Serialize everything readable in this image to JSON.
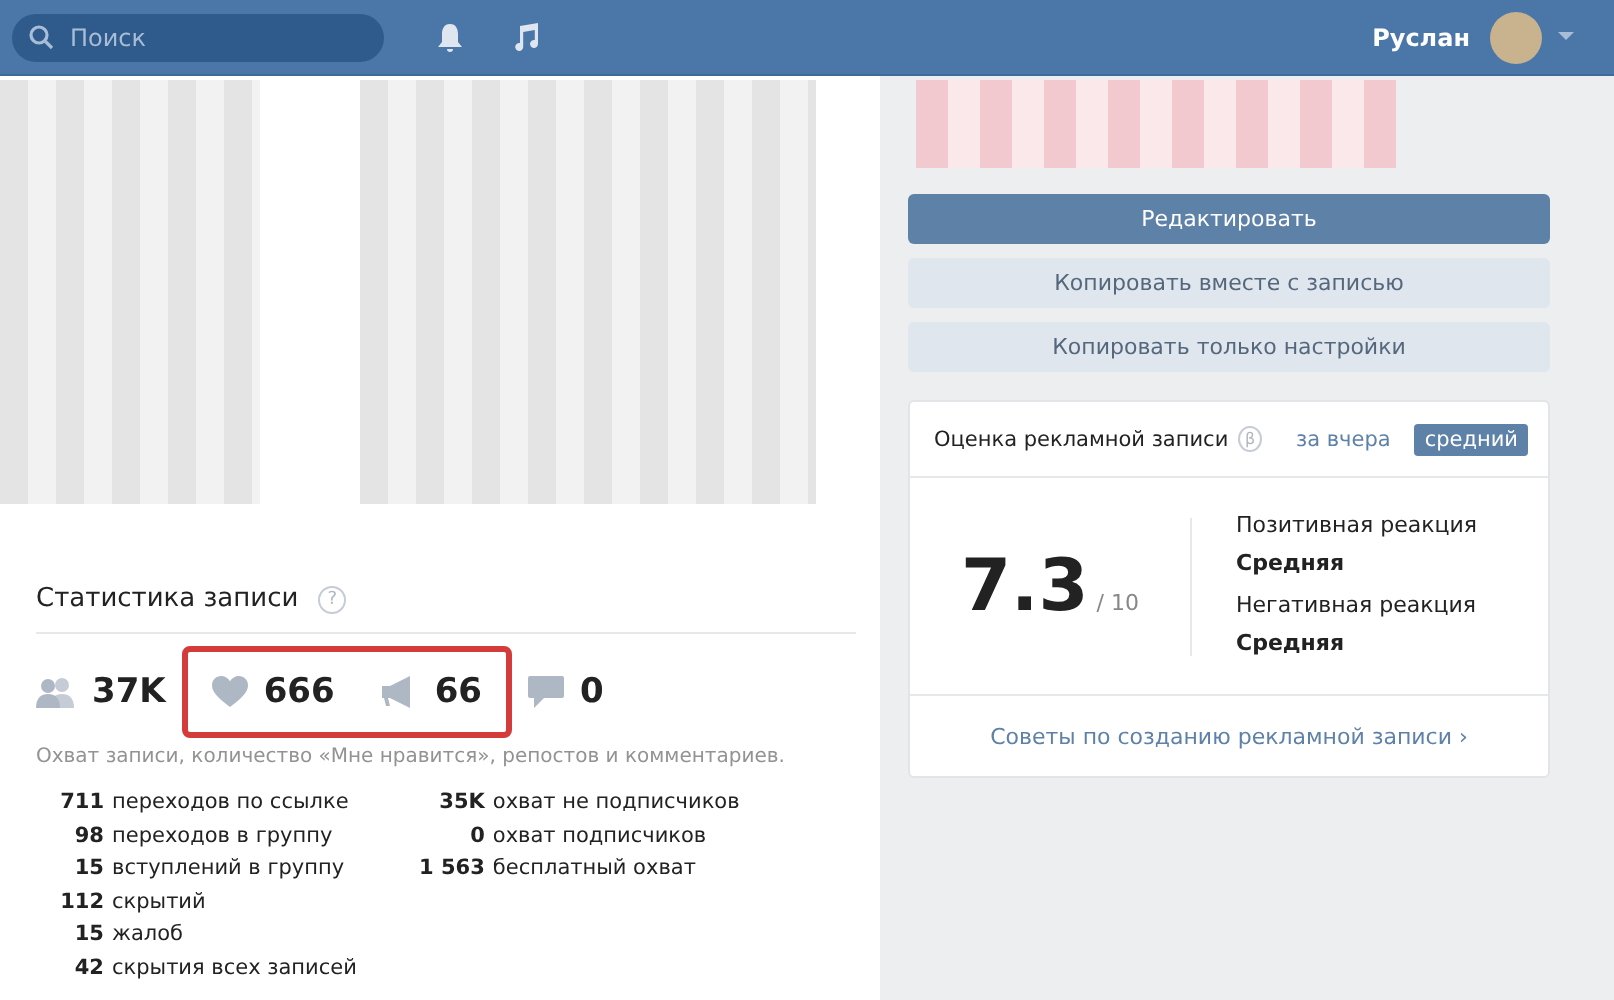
{
  "header": {
    "search": {
      "placeholder": "Поиск"
    },
    "user": {
      "name": "Руслан"
    }
  },
  "actions": [
    {
      "label": "Редактировать",
      "kind": "primary"
    },
    {
      "label": "Копировать вместе с записью",
      "kind": "secondary"
    },
    {
      "label": "Копировать только настройки",
      "kind": "secondary"
    }
  ],
  "rating": {
    "title": "Оценка рекламной записи",
    "info": "β",
    "tabs": [
      {
        "label": "за вчера",
        "selected": false
      },
      {
        "label": "средний",
        "selected": true
      }
    ],
    "score": "7.3",
    "scale": "/ 10",
    "reactions": [
      {
        "label": "Позитивная реакция",
        "value": "Средняя"
      },
      {
        "label": "Негативная реакция",
        "value": "Средняя"
      }
    ],
    "link": "Советы по созданию рекламной записи ›"
  },
  "stats": {
    "title": "Статистика записи",
    "help": "?",
    "counters": [
      {
        "kind": "reach",
        "value": "37K",
        "highlighted": false
      },
      {
        "kind": "likes",
        "value": "666",
        "highlighted": true
      },
      {
        "kind": "reposts",
        "value": "66",
        "highlighted": true
      },
      {
        "kind": "comments",
        "value": "0",
        "highlighted": false
      }
    ],
    "caption": "Охват записи, количество «Мне нравится», репостов и комментариев.",
    "left": [
      {
        "number": "711",
        "label": "переходов по ссылке"
      },
      {
        "number": "98",
        "label": "переходов в группу"
      },
      {
        "number": "15",
        "label": "вступлений в группу"
      },
      {
        "number": "112",
        "label": "скрытий"
      },
      {
        "number": "15",
        "label": "жалоб"
      },
      {
        "number": "42",
        "label": "скрытия всех записей"
      }
    ],
    "right": [
      {
        "number": "35K",
        "label": "охват не подписчиков"
      },
      {
        "number": "0",
        "label": "охват подписчиков"
      },
      {
        "number": "1 563",
        "label": "бесплатный охват"
      }
    ]
  }
}
